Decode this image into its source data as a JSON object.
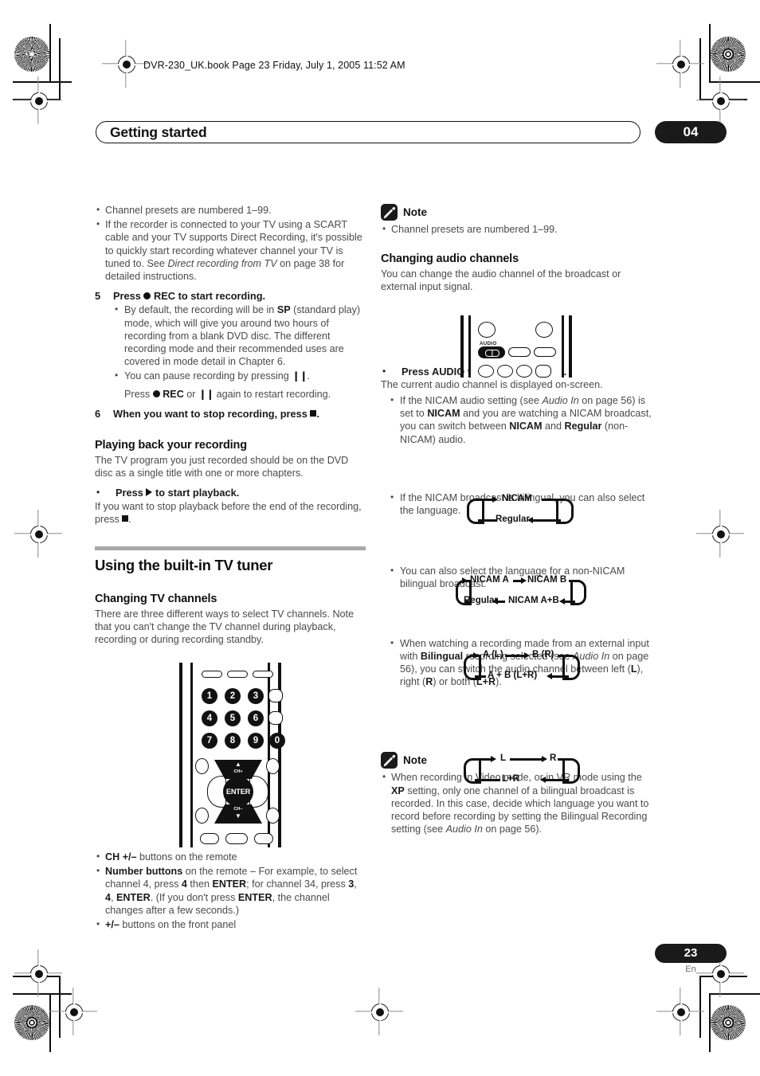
{
  "header": {
    "filestamp": "DVR-230_UK.book  Page 23  Friday, July 1, 2005  11:52 AM",
    "chapter_title": "Getting started",
    "chapter_number": "04"
  },
  "footer": {
    "page_number": "23",
    "language_code": "En"
  },
  "left_column": {
    "bullets_top": [
      "Channel presets are numbered 1–99.",
      "If the recorder is connected to your TV using a SCART cable and your TV supports Direct Recording, it's possible to quickly start recording whatever channel your TV is tuned to. See Direct recording from TV on page 38 for detailed instructions."
    ],
    "bullet2_pre": "If the recorder is connected to your TV using a SCART cable and your TV supports Direct Recording, it's possible to quickly start recording whatever channel your TV is tuned to. See ",
    "bullet2_italic": "Direct recording from TV",
    "bullet2_post": " on page 38 for detailed instructions.",
    "step5": {
      "number": "5",
      "text_pre": "Press ",
      "text_post": " REC to start recording."
    },
    "step5_bullets": {
      "b1_pre": "By default, the recording will be in ",
      "b1_bold": "SP",
      "b1_post": " (standard play) mode, which will give you around two hours of recording from a blank DVD disc. The different recording mode and their recommended uses are covered in mode detail in Chapter 6.",
      "b2_pre": "You can pause recording by pressing ",
      "b2_post": ".",
      "b2_line2_pre": "Press ",
      "b2_line2_mid": " REC",
      "b2_line2_or": " or ",
      "b2_line2_post": " again to restart recording."
    },
    "step6": {
      "number": "6",
      "text": "When you want to stop recording, press "
    },
    "playback_heading": "Playing back your recording",
    "playback_body": "The TV program you just recorded should be on the DVD disc as a single title with one or more chapters.",
    "playback_step": {
      "pre": "Press ",
      "post": " to start playback."
    },
    "playback_after_pre": "If you want to stop playback before the end of the recording, press ",
    "playback_after_post": ".",
    "section_heading": "Using the built-in TV tuner",
    "tv_channels_heading": "Changing TV channels",
    "tv_channels_body": "There are three different ways to select TV channels. Note that you can't change the TV channel during playback, recording or during recording standby.",
    "remote_keys": {
      "numbers": [
        "1",
        "2",
        "3",
        "4",
        "5",
        "6",
        "7",
        "8",
        "9",
        "0"
      ],
      "enter_label": "ENTER",
      "ch_up_label": "CH+",
      "ch_down_label": "CH–"
    },
    "methods": {
      "m1_bold": "CH +/–",
      "m1_rest": " buttons on the remote",
      "m2_bold": "Number buttons",
      "m2_p1": " on the remote – For example, to select channel 4, press ",
      "m2_b1": "4",
      "m2_p2": " then ",
      "m2_b2": "ENTER",
      "m2_p3": "; for channel 34, press ",
      "m2_b3": "3",
      "m2_p4": ", ",
      "m2_b4": "4",
      "m2_p5": ", ",
      "m2_b5": "ENTER",
      "m2_p6": ". (If you don't press ",
      "m2_b6": "ENTER",
      "m2_p7": ", the channel changes after a few seconds.)",
      "m3_bold": "+/–",
      "m3_rest": " buttons on the front panel"
    }
  },
  "right_column": {
    "note1": {
      "label": "Note",
      "icon": "pencil-icon",
      "bullet": "Channel presets are numbered 1–99."
    },
    "audio_heading": "Changing audio channels",
    "audio_body": "You can change the audio channel of the broadcast or external input signal.",
    "remote_audio_label": "AUDIO",
    "press_audio_step": "Press AUDIO to change the audio.",
    "press_audio_sub": "The current audio channel is displayed on-screen.",
    "nicam_bullet": {
      "p1": "If the NICAM audio setting (see ",
      "it1": "Audio In",
      "p2": " on page 56) is set to ",
      "b1": "NICAM",
      "p3": " and you are watching a NICAM broadcast, you can switch between ",
      "b2": "NICAM",
      "p4": " and ",
      "b3": "Regular",
      "p5": " (non-NICAM) audio."
    },
    "cycle1": [
      "NICAM",
      "Regular"
    ],
    "bilingual_bullet": "If the NICAM broadcast is bilingual, you can also select the language.",
    "cycle2": [
      "NICAM A",
      "NICAM B",
      "NICAM A+B",
      "Regular"
    ],
    "non_nicam_bullet": "You can also select the language for a non-NICAM bilingual broadcast.",
    "cycle3": [
      "A (L)",
      "B (R)",
      "A + B (L+R)"
    ],
    "external_bullet": {
      "p1": "When watching a recording made from an external input with ",
      "b1": "Bilingual",
      "p2": " recording selected (see ",
      "it1": "Audio In",
      "p3": " on page 56), you can switch the audio channel between left (",
      "b2": "L",
      "p4": "), right (",
      "b3": "R",
      "p5": ") or both (",
      "b4": "L+R",
      "p6": ")."
    },
    "cycle4": [
      "L",
      "R",
      "L+R"
    ],
    "note2": {
      "label": "Note",
      "icon": "pencil-icon",
      "p1": "When recording in Video mode, or in VR mode using the ",
      "b1": "XP",
      "p2": " setting, only one channel of a bilingual broadcast is recorded. In this case, decide which language you want to record before recording by setting the Bilingual Recording setting (see ",
      "it1": "Audio In",
      "p3": " on page 56)."
    }
  },
  "colors": {
    "ink": "#1a1a1a",
    "body_text": "#4a4a4a",
    "rule": "#a9a9a9",
    "mark": "#8a8a8a"
  }
}
